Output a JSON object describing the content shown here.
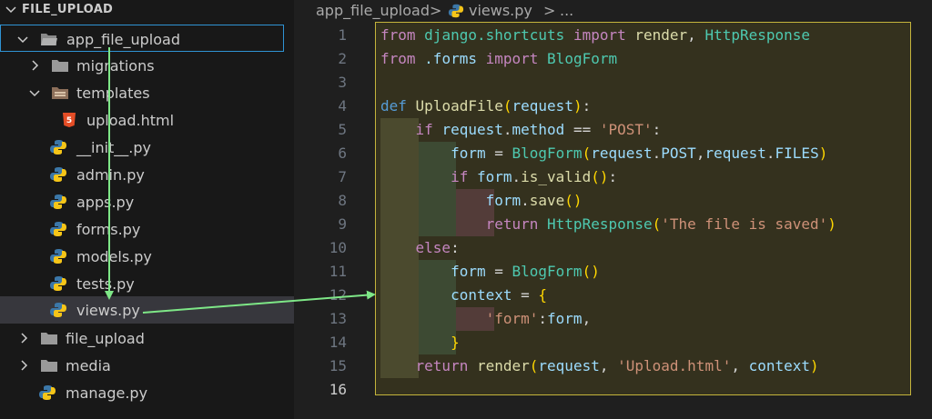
{
  "explorer": {
    "title": "FILE_UPLOAD",
    "items": [
      {
        "label": "app_file_upload",
        "kind": "folder-open"
      },
      {
        "label": "migrations",
        "kind": "folder"
      },
      {
        "label": "templates",
        "kind": "folder-open"
      },
      {
        "label": "upload.html",
        "kind": "html"
      },
      {
        "label": "__init__.py",
        "kind": "python"
      },
      {
        "label": "admin.py",
        "kind": "python"
      },
      {
        "label": "apps.py",
        "kind": "python"
      },
      {
        "label": "forms.py",
        "kind": "python"
      },
      {
        "label": "models.py",
        "kind": "python"
      },
      {
        "label": "tests.py",
        "kind": "python"
      },
      {
        "label": "views.py",
        "kind": "python"
      },
      {
        "label": "file_upload",
        "kind": "folder"
      },
      {
        "label": "media",
        "kind": "folder"
      },
      {
        "label": "manage.py",
        "kind": "python"
      }
    ]
  },
  "breadcrumb": {
    "folder": "app_file_upload",
    "sep1": ">",
    "file": "views.py",
    "sep2": ">",
    "more": "..."
  },
  "editor": {
    "line_numbers": [
      "1",
      "2",
      "3",
      "4",
      "5",
      "6",
      "7",
      "8",
      "9",
      "10",
      "11",
      "12",
      "13",
      "14",
      "15",
      "16"
    ],
    "lines": [
      [
        [
          "kw2",
          "from"
        ],
        [
          "op",
          " "
        ],
        [
          "cls",
          "django.shortcuts"
        ],
        [
          "op",
          " "
        ],
        [
          "kw2",
          "import"
        ],
        [
          "op",
          " "
        ],
        [
          "fn",
          "render"
        ],
        [
          "op",
          ", "
        ],
        [
          "cls",
          "HttpResponse"
        ]
      ],
      [
        [
          "kw2",
          "from"
        ],
        [
          "op",
          " "
        ],
        [
          "var",
          ".forms"
        ],
        [
          "op",
          " "
        ],
        [
          "kw2",
          "import"
        ],
        [
          "op",
          " "
        ],
        [
          "cls",
          "BlogForm"
        ]
      ],
      [],
      [
        [
          "kw",
          "def"
        ],
        [
          "op",
          " "
        ],
        [
          "fn",
          "UploadFile"
        ],
        [
          "br1",
          "("
        ],
        [
          "var",
          "request"
        ],
        [
          "br1",
          ")"
        ],
        [
          "op",
          ":"
        ]
      ],
      [
        [
          "op",
          "    "
        ],
        [
          "kw2",
          "if"
        ],
        [
          "op",
          " "
        ],
        [
          "var",
          "request"
        ],
        [
          "op",
          "."
        ],
        [
          "var",
          "method"
        ],
        [
          "op",
          " == "
        ],
        [
          "str",
          "'POST'"
        ],
        [
          "op",
          ":"
        ]
      ],
      [
        [
          "op",
          "        "
        ],
        [
          "var",
          "form"
        ],
        [
          "op",
          " = "
        ],
        [
          "cls",
          "BlogForm"
        ],
        [
          "br1",
          "("
        ],
        [
          "var",
          "request"
        ],
        [
          "op",
          "."
        ],
        [
          "var",
          "POST"
        ],
        [
          "op",
          ","
        ],
        [
          "var",
          "request"
        ],
        [
          "op",
          "."
        ],
        [
          "var",
          "FILES"
        ],
        [
          "br1",
          ")"
        ]
      ],
      [
        [
          "op",
          "        "
        ],
        [
          "kw2",
          "if"
        ],
        [
          "op",
          " "
        ],
        [
          "var",
          "form"
        ],
        [
          "op",
          "."
        ],
        [
          "fn",
          "is_valid"
        ],
        [
          "br1",
          "()"
        ],
        [
          "op",
          ":"
        ]
      ],
      [
        [
          "op",
          "            "
        ],
        [
          "var",
          "form"
        ],
        [
          "op",
          "."
        ],
        [
          "fn",
          "save"
        ],
        [
          "br1",
          "()"
        ]
      ],
      [
        [
          "op",
          "            "
        ],
        [
          "kw2",
          "return"
        ],
        [
          "op",
          " "
        ],
        [
          "cls",
          "HttpResponse"
        ],
        [
          "br1",
          "("
        ],
        [
          "str",
          "'The file is saved'"
        ],
        [
          "br1",
          ")"
        ]
      ],
      [
        [
          "op",
          "    "
        ],
        [
          "kw2",
          "else"
        ],
        [
          "op",
          ":"
        ]
      ],
      [
        [
          "op",
          "        "
        ],
        [
          "var",
          "form"
        ],
        [
          "op",
          " = "
        ],
        [
          "cls",
          "BlogForm"
        ],
        [
          "br1",
          "()"
        ]
      ],
      [
        [
          "op",
          "        "
        ],
        [
          "var",
          "context"
        ],
        [
          "op",
          " = "
        ],
        [
          "br1",
          "{"
        ]
      ],
      [
        [
          "op",
          "            "
        ],
        [
          "str",
          "'form'"
        ],
        [
          "op",
          ":"
        ],
        [
          "var",
          "form"
        ],
        [
          "op",
          ","
        ]
      ],
      [
        [
          "op",
          "        "
        ],
        [
          "br1",
          "}"
        ]
      ],
      [
        [
          "op",
          "    "
        ],
        [
          "kw2",
          "return"
        ],
        [
          "op",
          " "
        ],
        [
          "fn",
          "render"
        ],
        [
          "br1",
          "("
        ],
        [
          "var",
          "request"
        ],
        [
          "op",
          ", "
        ],
        [
          "str",
          "'Upload.html'"
        ],
        [
          "op",
          ", "
        ],
        [
          "var",
          "context"
        ],
        [
          "br1",
          ")"
        ]
      ],
      []
    ],
    "active_line": 16
  },
  "colors": {
    "focus_border": "#2f93d4",
    "highlight_border": "#c4b43c",
    "arrow": "#7ee787"
  }
}
